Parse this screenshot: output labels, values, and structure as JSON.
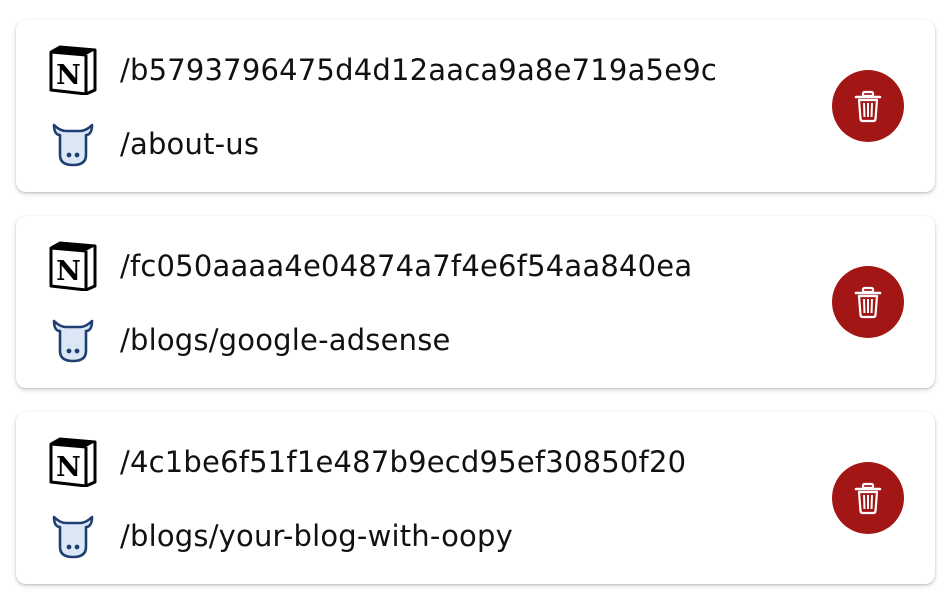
{
  "mappings": [
    {
      "notion_path": "/b5793796475d4d12aaca9a8e719a5e9c",
      "oopy_path": "/about-us",
      "notion_icon": "notion-logo-icon",
      "oopy_icon": "oopy-logo-icon",
      "delete_icon": "trash-icon"
    },
    {
      "notion_path": "/fc050aaaa4e04874a7f4e6f54aa840ea",
      "oopy_path": "/blogs/google-adsense",
      "notion_icon": "notion-logo-icon",
      "oopy_icon": "oopy-logo-icon",
      "delete_icon": "trash-icon"
    },
    {
      "notion_path": "/4c1be6f51f1e487b9ecd95ef30850f20",
      "oopy_path": "/blogs/your-blog-with-oopy",
      "notion_icon": "notion-logo-icon",
      "oopy_icon": "oopy-logo-icon",
      "delete_icon": "trash-icon"
    }
  ],
  "colors": {
    "delete_button": "#a31616",
    "oopy_outline": "#1f3f73",
    "oopy_fill": "#dbe7f5",
    "text": "#111111"
  }
}
